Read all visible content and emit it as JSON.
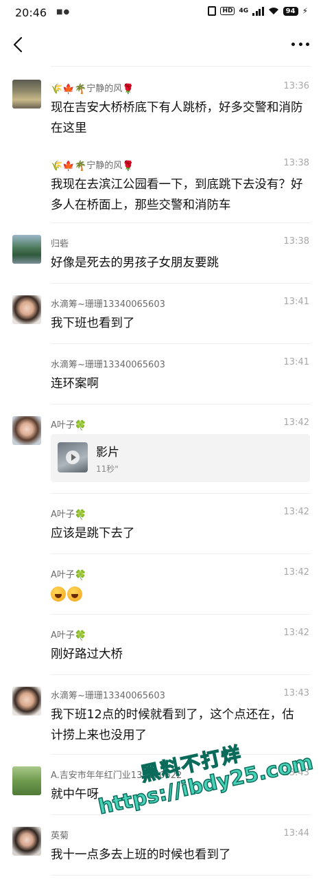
{
  "status_bar": {
    "time": "20:46",
    "notif_icons": "■●",
    "hd_label": "HD",
    "network_label": "4G",
    "battery": "94",
    "bolt": "ϟ"
  },
  "nav": {
    "back_icon": "chevron-left-icon",
    "more_icon": "more-dots-icon"
  },
  "comments": [
    {
      "name": "宁静的风",
      "name_decor": "🌾🍁🌴",
      "name_suffix": "🌹",
      "time": "13:36",
      "text": "现在吉安大桥桥底下有人跳桥，好多交警和消防在这里"
    },
    {
      "name": "宁静的风",
      "name_decor": "🌾🍁🌴",
      "name_suffix": "🌹",
      "time": "13:38",
      "text": "我现在去滨江公园看一下，到底跳下去没有？好多人在桥面上，那些交警和消防车"
    },
    {
      "name": "归砦",
      "time": "13:38",
      "text": "好像是死去的男孩子女朋友要跳"
    },
    {
      "name": "水滴筹~珊珊13340065603",
      "time": "13:41",
      "text": "我下班也看到了"
    },
    {
      "name": "水滴筹~珊珊13340065603",
      "time": "13:41",
      "text": "连环案啊"
    },
    {
      "name": "A叶子",
      "name_suffix": "🍀",
      "time": "13:42",
      "video_title": "影片",
      "video_duration": "11秒\""
    },
    {
      "name": "A叶子",
      "name_suffix": "🍀",
      "time": "13:42",
      "text": "应该是跳下去了"
    },
    {
      "name": "A叶子",
      "name_suffix": "🍀",
      "time": "13:42"
    },
    {
      "name": "A叶子",
      "name_suffix": "🍀",
      "time": "13:42",
      "text": "刚好路过大桥"
    },
    {
      "name": "水滴筹~珊珊13340065603",
      "time": "13:43",
      "text": "我下班12点的时候就看到了，这个点还在，估计捞上来也没用了"
    },
    {
      "name": "A.吉安市年年红门业137070622",
      "time": "13:43",
      "text": "就中午呀"
    },
    {
      "name": "英菊",
      "time": "13:44",
      "text": "我十一点多去上班的时候也看到了"
    }
  ],
  "watermark": {
    "line1": "黑料不打烊",
    "line2": "https://ibdy25.com"
  }
}
